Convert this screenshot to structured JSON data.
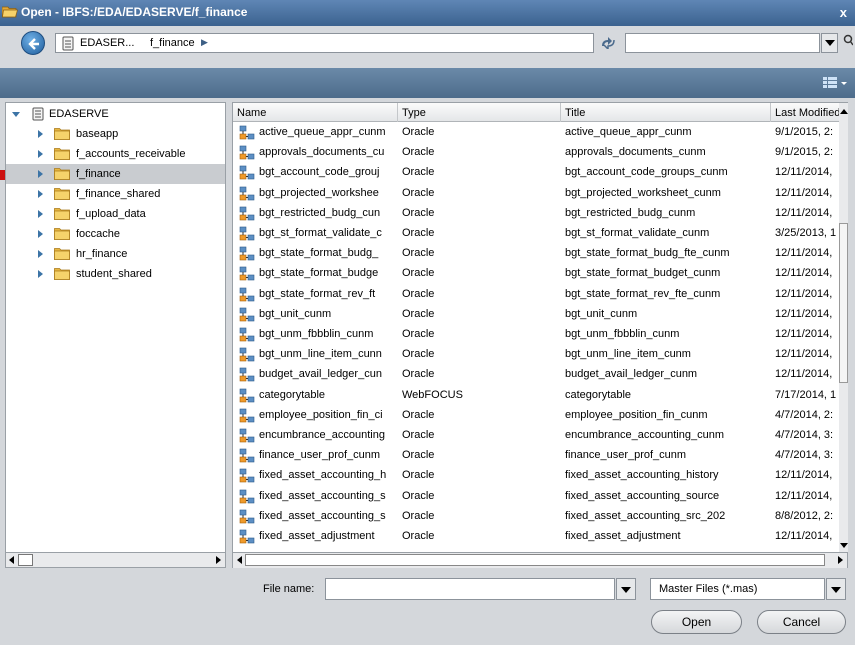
{
  "window": {
    "title": "Open - IBFS:/EDA/EDASERVE/f_finance",
    "close_glyph": "x"
  },
  "nav": {
    "breadcrumb": [
      "EDASER...",
      "f_finance",
      "▶"
    ],
    "search_value": ""
  },
  "tree": {
    "root": "EDASERVE",
    "items": [
      {
        "label": "baseapp",
        "selected": false
      },
      {
        "label": "f_accounts_receivable",
        "selected": false
      },
      {
        "label": "f_finance",
        "selected": true
      },
      {
        "label": "f_finance_shared",
        "selected": false
      },
      {
        "label": "f_upload_data",
        "selected": false
      },
      {
        "label": "foccache",
        "selected": false
      },
      {
        "label": "hr_finance",
        "selected": false
      },
      {
        "label": "student_shared",
        "selected": false
      }
    ]
  },
  "list": {
    "columns": [
      "Name",
      "Type",
      "Title",
      "Last Modified"
    ],
    "rows": [
      {
        "name": "active_queue_appr_cunm",
        "type": "Oracle",
        "title": "active_queue_appr_cunm",
        "modified": "9/1/2015, 2:"
      },
      {
        "name": "approvals_documents_cu",
        "type": "Oracle",
        "title": "approvals_documents_cunm",
        "modified": "9/1/2015, 2:"
      },
      {
        "name": "bgt_account_code_grouj",
        "type": "Oracle",
        "title": "bgt_account_code_groups_cunm",
        "modified": "12/11/2014,"
      },
      {
        "name": "bgt_projected_workshee",
        "type": "Oracle",
        "title": "bgt_projected_worksheet_cunm",
        "modified": "12/11/2014,"
      },
      {
        "name": "bgt_restricted_budg_cun",
        "type": "Oracle",
        "title": "bgt_restricted_budg_cunm",
        "modified": "12/11/2014,"
      },
      {
        "name": "bgt_st_format_validate_c",
        "type": "Oracle",
        "title": "bgt_st_format_validate_cunm",
        "modified": "3/25/2013, 1"
      },
      {
        "name": "bgt_state_format_budg_",
        "type": "Oracle",
        "title": "bgt_state_format_budg_fte_cunm",
        "modified": "12/11/2014,"
      },
      {
        "name": "bgt_state_format_budge",
        "type": "Oracle",
        "title": "bgt_state_format_budget_cunm",
        "modified": "12/11/2014,"
      },
      {
        "name": "bgt_state_format_rev_ft",
        "type": "Oracle",
        "title": "bgt_state_format_rev_fte_cunm",
        "modified": "12/11/2014,"
      },
      {
        "name": "bgt_unit_cunm",
        "type": "Oracle",
        "title": "bgt_unit_cunm",
        "modified": "12/11/2014,"
      },
      {
        "name": "bgt_unm_fbbblin_cunm",
        "type": "Oracle",
        "title": "bgt_unm_fbbblin_cunm",
        "modified": "12/11/2014,"
      },
      {
        "name": "bgt_unm_line_item_cunn",
        "type": "Oracle",
        "title": "bgt_unm_line_item_cunm",
        "modified": "12/11/2014,"
      },
      {
        "name": "budget_avail_ledger_cun",
        "type": "Oracle",
        "title": "budget_avail_ledger_cunm",
        "modified": "12/11/2014,"
      },
      {
        "name": "categorytable",
        "type": "WebFOCUS",
        "title": "categorytable",
        "modified": "7/17/2014, 1"
      },
      {
        "name": "employee_position_fin_ci",
        "type": "Oracle",
        "title": "employee_position_fin_cunm",
        "modified": "4/7/2014, 2:"
      },
      {
        "name": "encumbrance_accounting",
        "type": "Oracle",
        "title": "encumbrance_accounting_cunm",
        "modified": "4/7/2014, 3:"
      },
      {
        "name": "finance_user_prof_cunm",
        "type": "Oracle",
        "title": "finance_user_prof_cunm",
        "modified": "4/7/2014, 3:"
      },
      {
        "name": "fixed_asset_accounting_h",
        "type": "Oracle",
        "title": "fixed_asset_accounting_history",
        "modified": "12/11/2014,"
      },
      {
        "name": "fixed_asset_accounting_s",
        "type": "Oracle",
        "title": "fixed_asset_accounting_source",
        "modified": "12/11/2014,"
      },
      {
        "name": "fixed_asset_accounting_s",
        "type": "Oracle",
        "title": "fixed_asset_accounting_src_202",
        "modified": "8/8/2012, 2:"
      },
      {
        "name": "fixed_asset_adjustment",
        "type": "Oracle",
        "title": "fixed_asset_adjustment",
        "modified": "12/11/2014,"
      }
    ]
  },
  "footer": {
    "file_name_label": "File name:",
    "file_name_value": "",
    "file_type": "Master Files (*.mas)",
    "open_label": "Open",
    "cancel_label": "Cancel"
  },
  "colors": {
    "titlebar": "#3b628f",
    "toolbar": "#5b7a99",
    "selected": "#c9ccd0",
    "folder": "#f1c34a",
    "annotation_arrow": "#cc1111"
  }
}
